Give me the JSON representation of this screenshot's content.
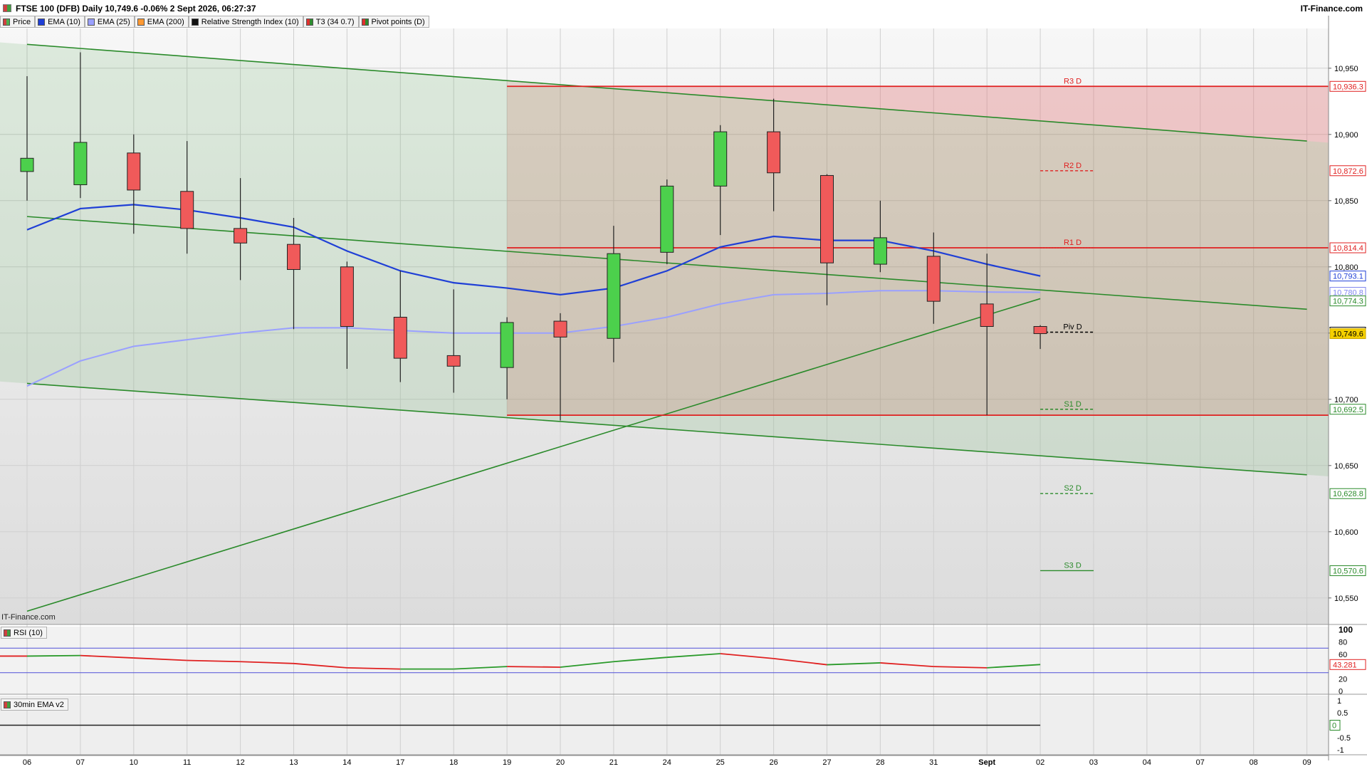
{
  "header": {
    "title": "FTSE 100 (DFB) Daily 10,749.6 -0.06% 2 Sept 2026, 06:27:37",
    "brand": "IT-Finance.com"
  },
  "legend": [
    {
      "label": "Price",
      "color": "#4caf50"
    },
    {
      "label": "EMA (10)",
      "color": "#1f3fd6"
    },
    {
      "label": "EMA (25)",
      "color": "#9aa0ff"
    },
    {
      "label": "EMA (200)",
      "color": "#ff9933"
    },
    {
      "label": "Relative Strength Index (10)",
      "color": "#111111"
    },
    {
      "label": "T3 (34 0.7)",
      "color": "#e03030"
    },
    {
      "label": "Pivot points (D)",
      "color": "#2e8b2e"
    }
  ],
  "watermark": "IT-Finance.com",
  "colors": {
    "up": "#4cd04c",
    "down": "#f05a5a",
    "ema10": "#1f3fd6",
    "ema25": "#9aa0ff",
    "resistance": "#e02020",
    "support": "#2a8a2a",
    "trend": "#2a8a2a"
  },
  "chart_data": [
    {
      "type": "candlestick",
      "title": "FTSE 100 (DFB) Daily",
      "x_labels": [
        "06",
        "07",
        "10",
        "11",
        "12",
        "13",
        "14",
        "17",
        "18",
        "19",
        "20",
        "21",
        "24",
        "25",
        "26",
        "27",
        "28",
        "31",
        "Sept",
        "02",
        "03",
        "04",
        "07",
        "08",
        "09"
      ],
      "ylim": [
        10530,
        10980
      ],
      "yticks": [
        10550,
        10600,
        10650,
        10700,
        10750,
        10800,
        10850,
        10900,
        10950
      ],
      "yticks_text": [
        "10,550",
        "10,600",
        "10,650",
        "10,700",
        "10,750",
        "10,800",
        "10,850",
        "10,900",
        "10,950"
      ],
      "candles": [
        {
          "date": "06",
          "open": 10872,
          "high": 10944,
          "low": 10850,
          "close": 10882
        },
        {
          "date": "07",
          "open": 10862,
          "high": 10962,
          "low": 10852,
          "close": 10894
        },
        {
          "date": "10",
          "open": 10886,
          "high": 10900,
          "low": 10825,
          "close": 10858
        },
        {
          "date": "11",
          "open": 10857,
          "high": 10895,
          "low": 10810,
          "close": 10829
        },
        {
          "date": "12",
          "open": 10829,
          "high": 10867,
          "low": 10790,
          "close": 10818
        },
        {
          "date": "13",
          "open": 10817,
          "high": 10837,
          "low": 10753,
          "close": 10798
        },
        {
          "date": "14",
          "open": 10800,
          "high": 10804,
          "low": 10723,
          "close": 10755
        },
        {
          "date": "17",
          "open": 10762,
          "high": 10797,
          "low": 10713,
          "close": 10731
        },
        {
          "date": "18",
          "open": 10733,
          "high": 10783,
          "low": 10705,
          "close": 10725
        },
        {
          "date": "19",
          "open": 10724,
          "high": 10762,
          "low": 10700,
          "close": 10758
        },
        {
          "date": "20",
          "open": 10759,
          "high": 10765,
          "low": 10684,
          "close": 10747
        },
        {
          "date": "21",
          "open": 10746,
          "high": 10831,
          "low": 10728,
          "close": 10810
        },
        {
          "date": "24",
          "open": 10811,
          "high": 10866,
          "low": 10802,
          "close": 10861
        },
        {
          "date": "25",
          "open": 10861,
          "high": 10907,
          "low": 10824,
          "close": 10902
        },
        {
          "date": "26",
          "open": 10902,
          "high": 10927,
          "low": 10842,
          "close": 10871
        },
        {
          "date": "27",
          "open": 10869,
          "high": 10870,
          "low": 10771,
          "close": 10803
        },
        {
          "date": "28",
          "open": 10802,
          "high": 10850,
          "low": 10796,
          "close": 10822
        },
        {
          "date": "31",
          "open": 10808,
          "high": 10826,
          "low": 10757,
          "close": 10774
        },
        {
          "date": "Sept",
          "open": 10772,
          "high": 10810,
          "low": 10688,
          "close": 10755
        },
        {
          "date": "02",
          "open": 10755,
          "high": 10756,
          "low": 10738,
          "close": 10749.6
        }
      ],
      "series": [
        {
          "name": "EMA (10)",
          "values": [
            10828,
            10844,
            10847,
            10843,
            10837,
            10830,
            10812,
            10797,
            10788,
            10784,
            10779,
            10784,
            10797,
            10815,
            10823,
            10820,
            10820,
            10812,
            10802,
            10793.1
          ]
        },
        {
          "name": "EMA (25)",
          "values": [
            10710,
            10729,
            10740,
            10745,
            10750,
            10754,
            10754,
            10752,
            10750,
            10750,
            10750,
            10755,
            10762,
            10772,
            10779,
            10780,
            10782,
            10782,
            10781,
            10780.8
          ]
        }
      ],
      "pivots": [
        {
          "label": "R3 D",
          "value": 10936.3,
          "value_text": "10,936.3"
        },
        {
          "label": "R2 D",
          "value": 10872.6,
          "value_text": "10,872.6"
        },
        {
          "label": "R1 D",
          "value": 10814.4,
          "value_text": "10,814.4"
        },
        {
          "label": "Piv D",
          "value": 10750.7,
          "value_text": "10,750.7"
        },
        {
          "label": "S1 D",
          "value": 10692.5,
          "value_text": "10,692.5"
        },
        {
          "label": "S2 D",
          "value": 10628.8,
          "value_text": "10,628.8"
        },
        {
          "label": "S3 D",
          "value": 10570.6,
          "value_text": "10,570.6"
        }
      ],
      "price_tags": [
        {
          "value": 10793.1,
          "text": "10,793.1",
          "color": "#1f3fd6",
          "bg": "#ffffff"
        },
        {
          "value": 10780.8,
          "text": "10,780.8",
          "color": "#7f86ee",
          "bg": "#ffffff"
        },
        {
          "value": 10774.3,
          "text": "10,774.3",
          "color": "#2a8a2a",
          "bg": "#ffffff"
        },
        {
          "value": 10749.6,
          "text": "10,749.6",
          "color": "#000000",
          "bg": "#f5d000"
        }
      ],
      "horizontal_levels": [
        {
          "value": 10936.3,
          "from": "19",
          "color": "#e02020"
        },
        {
          "value": 10814.4,
          "from": "19",
          "color": "#e02020"
        },
        {
          "value": 10688,
          "from": "19",
          "color": "#e02020"
        }
      ],
      "trendlines": [
        {
          "from_date": "06",
          "from_value": 10968,
          "to_date": "09",
          "to_value": 10895
        },
        {
          "from_date": "06",
          "from_value": 10838,
          "to_date": "09",
          "to_value": 10768
        },
        {
          "from_date": "06",
          "from_value": 10712,
          "to_date": "09",
          "to_value": 10643
        },
        {
          "from_date": "06",
          "from_value": 10540,
          "to_date": "02",
          "to_value": 10776
        }
      ]
    },
    {
      "type": "line",
      "title": "RSI (10)",
      "ylim": [
        -5,
        105
      ],
      "yticks": [
        0,
        20,
        40,
        60,
        80,
        100
      ],
      "yticks_text": [
        "0",
        "20",
        "40",
        "60",
        "80",
        "100"
      ],
      "levels": [
        70,
        30
      ],
      "values": [
        57,
        58,
        54,
        50,
        48,
        45,
        38,
        36,
        36,
        40,
        39,
        48,
        55,
        61,
        53,
        43,
        46,
        40,
        38,
        43.281
      ],
      "last_value_text": "43.281",
      "colors": {
        "rising": "#2a9a2a",
        "falling": "#e02020"
      }
    },
    {
      "type": "line",
      "title": "30min EMA v2",
      "ylim": [
        -1.2,
        1.2
      ],
      "yticks": [
        -1,
        -0.5,
        0,
        0.5,
        1
      ],
      "yticks_text": [
        "-1",
        "-0.5",
        "0",
        "0.5",
        "1"
      ],
      "values": [
        0,
        0,
        0,
        0,
        0,
        0,
        0,
        0,
        0,
        0,
        0,
        0,
        0,
        0,
        0,
        0,
        0,
        0,
        0,
        0
      ],
      "last_value_text": "0"
    }
  ]
}
